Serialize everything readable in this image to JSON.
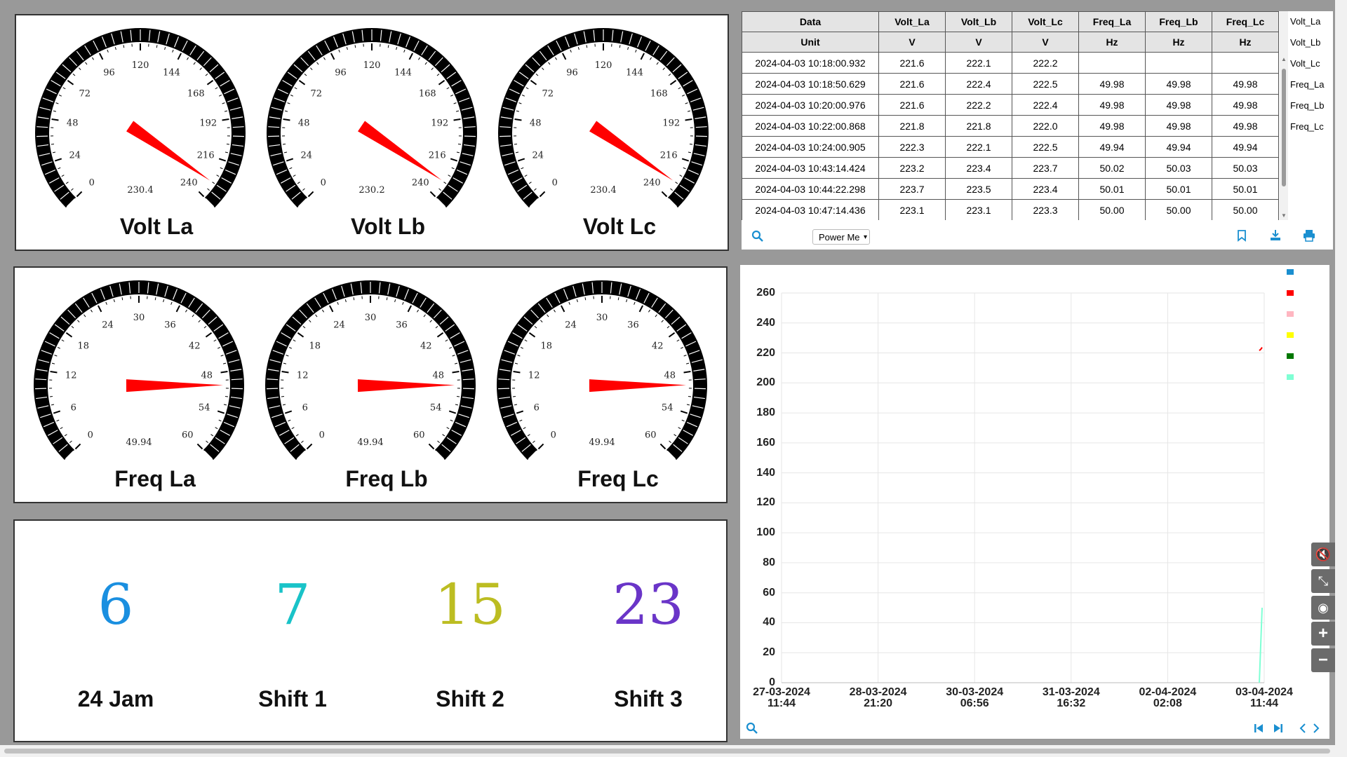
{
  "volt_gauges": [
    {
      "title": "Volt La",
      "value": "230.4",
      "needle": 230.4,
      "ticks": [
        "0",
        "24",
        "48",
        "72",
        "96",
        "120",
        "144",
        "168",
        "192",
        "216",
        "240"
      ],
      "max": 240
    },
    {
      "title": "Volt Lb",
      "value": "230.2",
      "needle": 230.2,
      "ticks": [
        "0",
        "24",
        "48",
        "72",
        "96",
        "120",
        "144",
        "168",
        "192",
        "216",
        "240"
      ],
      "max": 240
    },
    {
      "title": "Volt Lc",
      "value": "230.4",
      "needle": 230.4,
      "ticks": [
        "0",
        "24",
        "48",
        "72",
        "96",
        "120",
        "144",
        "168",
        "192",
        "216",
        "240"
      ],
      "max": 240
    }
  ],
  "freq_gauges": [
    {
      "title": "Freq La",
      "value": "49.94",
      "needle": 49.94,
      "ticks": [
        "0",
        "6",
        "12",
        "18",
        "24",
        "30",
        "36",
        "42",
        "48",
        "54",
        "60"
      ],
      "max": 60
    },
    {
      "title": "Freq Lb",
      "value": "49.94",
      "needle": 49.94,
      "ticks": [
        "0",
        "6",
        "12",
        "18",
        "24",
        "30",
        "36",
        "42",
        "48",
        "54",
        "60"
      ],
      "max": 60
    },
    {
      "title": "Freq Lc",
      "value": "49.94",
      "needle": 49.94,
      "ticks": [
        "0",
        "6",
        "12",
        "18",
        "24",
        "30",
        "36",
        "42",
        "48",
        "54",
        "60"
      ],
      "max": 60
    }
  ],
  "counters": [
    {
      "value": "6",
      "label": "24 Jam",
      "color": "#1a8fe0"
    },
    {
      "value": "7",
      "label": "Shift 1",
      "color": "#19c3c8"
    },
    {
      "value": "15",
      "label": "Shift 2",
      "color": "#bcbd22"
    },
    {
      "value": "23",
      "label": "Shift 3",
      "color": "#6a35c8"
    }
  ],
  "table": {
    "headers": [
      "Data",
      "Volt_La",
      "Volt_Lb",
      "Volt_Lc",
      "Freq_La",
      "Freq_Lb",
      "Freq_Lc"
    ],
    "units": [
      "Unit",
      "V",
      "V",
      "V",
      "Hz",
      "Hz",
      "Hz"
    ],
    "rows": [
      [
        "2024-04-03 10:18:00.932",
        "221.6",
        "222.1",
        "222.2",
        "",
        "",
        ""
      ],
      [
        "2024-04-03 10:18:50.629",
        "221.6",
        "222.4",
        "222.5",
        "49.98",
        "49.98",
        "49.98"
      ],
      [
        "2024-04-03 10:20:00.976",
        "221.6",
        "222.2",
        "222.4",
        "49.98",
        "49.98",
        "49.98"
      ],
      [
        "2024-04-03 10:22:00.868",
        "221.8",
        "221.8",
        "222.0",
        "49.98",
        "49.98",
        "49.98"
      ],
      [
        "2024-04-03 10:24:00.905",
        "222.3",
        "222.1",
        "222.5",
        "49.94",
        "49.94",
        "49.94"
      ],
      [
        "2024-04-03 10:43:14.424",
        "223.2",
        "223.4",
        "223.7",
        "50.02",
        "50.03",
        "50.03"
      ],
      [
        "2024-04-03 10:44:22.298",
        "223.7",
        "223.5",
        "223.4",
        "50.01",
        "50.01",
        "50.01"
      ],
      [
        "2024-04-03 10:47:14.436",
        "223.1",
        "223.1",
        "223.3",
        "50.00",
        "50.00",
        "50.00"
      ]
    ],
    "legend": [
      "Volt_La",
      "Volt_Lb",
      "Volt_Lc",
      "Freq_La",
      "Freq_Lb",
      "Freq_Lc"
    ],
    "select_value": "Power Me"
  },
  "chart_data": {
    "type": "line",
    "y_ticks": [
      "260",
      "240",
      "220",
      "200",
      "180",
      "160",
      "140",
      "120",
      "100",
      "80",
      "60",
      "40",
      "20",
      "0"
    ],
    "x_ticks": [
      [
        "27-03-2024",
        "11:44"
      ],
      [
        "28-03-2024",
        "21:20"
      ],
      [
        "30-03-2024",
        "06:56"
      ],
      [
        "31-03-2024",
        "16:32"
      ],
      [
        "02-04-2024",
        "02:08"
      ],
      [
        "03-04-2024",
        "11:44"
      ]
    ],
    "ylim": [
      0,
      260
    ],
    "legend_colors": [
      "#1a8fd0",
      "#ff0000",
      "#ffb6c1",
      "#ffff00",
      "#007700",
      "#7fffd4"
    ],
    "series": [
      {
        "color": "#ff0000",
        "values": [
          221.6,
          222.4,
          223.7
        ]
      },
      {
        "color": "#7fffd4",
        "values": [
          0,
          50
        ]
      }
    ]
  },
  "tools": [
    "mute-icon",
    "collapse-icon",
    "eye-icon",
    "plus-icon",
    "minus-icon"
  ]
}
